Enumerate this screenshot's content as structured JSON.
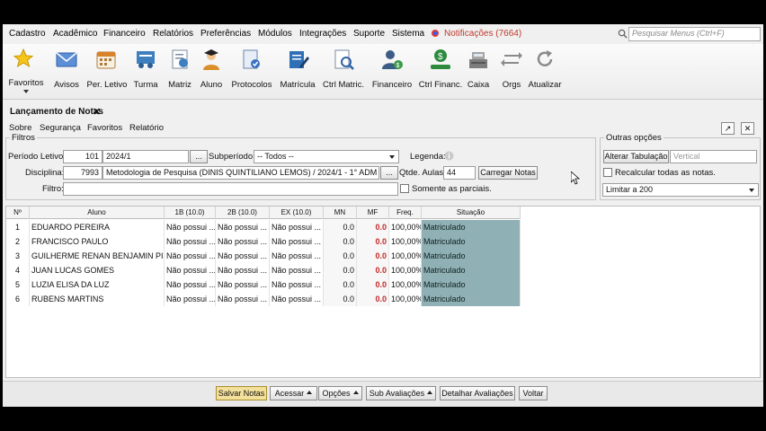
{
  "menu": [
    "Cadastro",
    "Acadêmico",
    "Financeiro",
    "Relatórios",
    "Preferências",
    "Módulos",
    "Integrações",
    "Suporte",
    "Sistema"
  ],
  "notifications": "Notificações (7664)",
  "search_placeholder": "Pesquisar Menus (Ctrl+F)",
  "toolbar": [
    "Favoritos",
    "Avisos",
    "Per. Letivo",
    "Turma",
    "Matriz",
    "Aluno",
    "Protocolos",
    "Matrícula",
    "Ctrl Matric.",
    "Financeiro",
    "Ctrl Financ.",
    "Caixa",
    "Orgs",
    "Atualizar"
  ],
  "tab_title": "Lançamento de Notas",
  "tab_close": "✕",
  "subnav": [
    "Sobre",
    "Segurança",
    "Favoritos",
    "Relatório"
  ],
  "filters": {
    "title": "Filtros",
    "periodo_label": "Período Letivo:",
    "periodo_code": "101",
    "periodo_value": "2024/1",
    "browse": "...",
    "subperiodo_label": "Subperíodo:",
    "subperiodo_value": "-- Todos --",
    "legenda_label": "Legenda:",
    "disciplina_label": "Disciplina:",
    "disciplina_code": "7993",
    "disciplina_value": "Metodologia de Pesquisa (DINIS QUINTILIANO LEMOS) / 2024/1 - 1° ADM",
    "qtde_label": "Qtde. Aulas:",
    "qtde_value": "44",
    "carregar": "Carregar Notas",
    "filtro_label": "Filtro:",
    "parciais": "Somente as parciais."
  },
  "outras": {
    "title": "Outras opções",
    "alterar": "Alterar Tabulação",
    "vertical": "Vertical",
    "recalcular": "Recalcular todas as notas.",
    "limitar": "Limitar a 200"
  },
  "table": {
    "headers": [
      "Nº",
      "Aluno",
      "1B (10.0)",
      "2B (10.0)",
      "EX (10.0)",
      "MN",
      "MF",
      "Freq.",
      "Situação"
    ],
    "rows": [
      [
        "1",
        "EDUARDO PEREIRA",
        "Não possui ...",
        "Não possui ...",
        "Não possui ...",
        "0.0",
        "0.0",
        "100,00%",
        "Matriculado"
      ],
      [
        "2",
        "FRANCISCO PAULO",
        "Não possui ...",
        "Não possui ...",
        "Não possui ...",
        "0.0",
        "0.0",
        "100,00%",
        "Matriculado"
      ],
      [
        "3",
        "GUILHERME RENAN BENJAMIN PIR...",
        "Não possui ...",
        "Não possui ...",
        "Não possui ...",
        "0.0",
        "0.0",
        "100,00%",
        "Matriculado"
      ],
      [
        "4",
        "JUAN LUCAS GOMES",
        "Não possui ...",
        "Não possui ...",
        "Não possui ...",
        "0.0",
        "0.0",
        "100,00%",
        "Matriculado"
      ],
      [
        "5",
        "LUZIA ELISA DA LUZ",
        "Não possui ...",
        "Não possui ...",
        "Não possui ...",
        "0.0",
        "0.0",
        "100,00%",
        "Matriculado"
      ],
      [
        "6",
        "RUBENS MARTINS",
        "Não possui ...",
        "Não possui ...",
        "Não possui ...",
        "0.0",
        "0.0",
        "100,00%",
        "Matriculado"
      ]
    ]
  },
  "bottom": [
    "Salvar Notas",
    "Acessar",
    "Opções",
    "Sub Avaliações",
    "Detalhar Avaliações",
    "Voltar"
  ],
  "colors": {
    "status_fill": "#8fb0b4",
    "mf_text": "#c62828",
    "primary_button": "#f3e09b"
  }
}
